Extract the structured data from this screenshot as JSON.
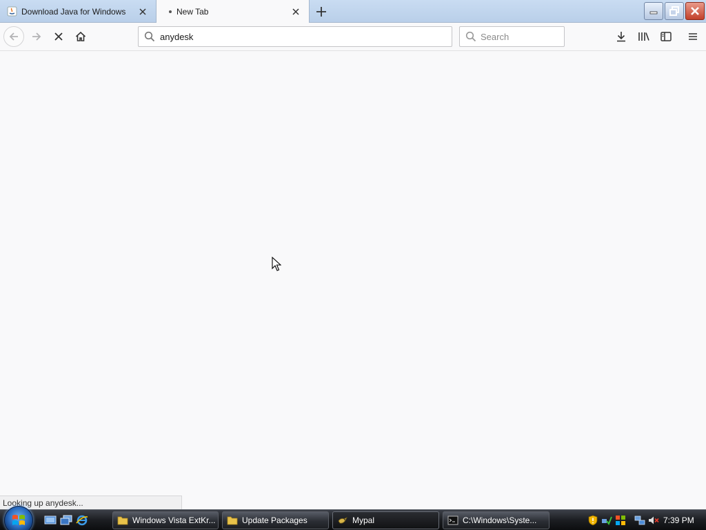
{
  "tabs": [
    {
      "label": "Download Java for Windows",
      "active": false,
      "favicon": "java-icon"
    },
    {
      "label": "New Tab",
      "active": true,
      "loading": true
    }
  ],
  "navbar": {
    "url_value": "anydesk",
    "search_placeholder": "Search",
    "reload_state": "stop-icon"
  },
  "status": {
    "text": "Looking up anydesk..."
  },
  "taskbar": {
    "buttons": [
      {
        "label": "Windows Vista ExtKr...",
        "icon": "folder-icon"
      },
      {
        "label": "Update Packages",
        "icon": "folder-icon"
      },
      {
        "label": "Mypal",
        "icon": "mypal-icon",
        "active": true
      },
      {
        "label": "C:\\Windows\\Syste...",
        "icon": "cmd-icon"
      }
    ],
    "clock": "7:39 PM"
  },
  "colors": {
    "tabstrip": "#c9dcf2",
    "chrome": "#f9f9fa",
    "taskbar": "#1c1e22",
    "close_button": "#c2402a"
  }
}
